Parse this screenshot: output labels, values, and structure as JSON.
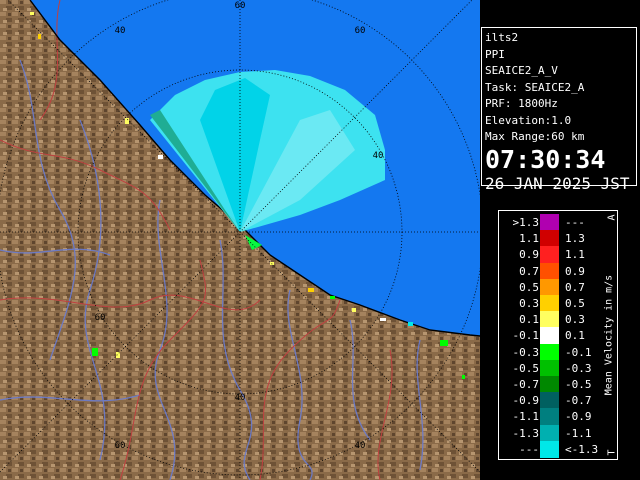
{
  "info": {
    "site": "ilts2",
    "product": "PPI",
    "scan": "SEAICE2_A_V",
    "task": "Task: SEAICE2_A",
    "prf": "PRF: 1800Hz",
    "elevation": "Elevation:1.0",
    "max_range": "Max Range:60 km",
    "time": "07:30:34",
    "date": "26 JAN 2025 JST"
  },
  "legend": {
    "title": "Mean Velocity in m/s",
    "corner_top": "A",
    "corner_bottom": "T",
    "rows": [
      {
        "left": ">1.3",
        "right": "---",
        "color": "#b000b0"
      },
      {
        "left": "1.1",
        "right": "1.3",
        "color": "#d00000"
      },
      {
        "left": "0.9",
        "right": "1.1",
        "color": "#ff2020"
      },
      {
        "left": "0.7",
        "right": "0.9",
        "color": "#ff5000"
      },
      {
        "left": "0.5",
        "right": "0.7",
        "color": "#ff9800"
      },
      {
        "left": "0.3",
        "right": "0.5",
        "color": "#ffd000"
      },
      {
        "left": "0.1",
        "right": "0.3",
        "color": "#ffff60"
      },
      {
        "left": "-0.1",
        "right": "0.1",
        "color": "#ffffff"
      },
      {
        "left": "-0.3",
        "right": "-0.1",
        "color": "#00ff00"
      },
      {
        "left": "-0.5",
        "right": "-0.3",
        "color": "#00c000"
      },
      {
        "left": "-0.7",
        "right": "-0.5",
        "color": "#008800"
      },
      {
        "left": "-0.9",
        "right": "-0.7",
        "color": "#006060"
      },
      {
        "left": "-1.1",
        "right": "-0.9",
        "color": "#007f7f"
      },
      {
        "left": "-1.3",
        "right": "-1.1",
        "color": "#00b0b0"
      },
      {
        "left": "---",
        "right": "<-1.3",
        "color": "#00e8e8"
      }
    ]
  },
  "map": {
    "ring_labels": [
      "40",
      "60",
      "40",
      "60",
      "40",
      "60",
      "40",
      "60"
    ],
    "colors": {
      "sea": "#1478f0",
      "land": "#8a6a48",
      "echo": "#40e8f0",
      "rivers": "#6a7cd0",
      "borders": "#c04040"
    }
  }
}
